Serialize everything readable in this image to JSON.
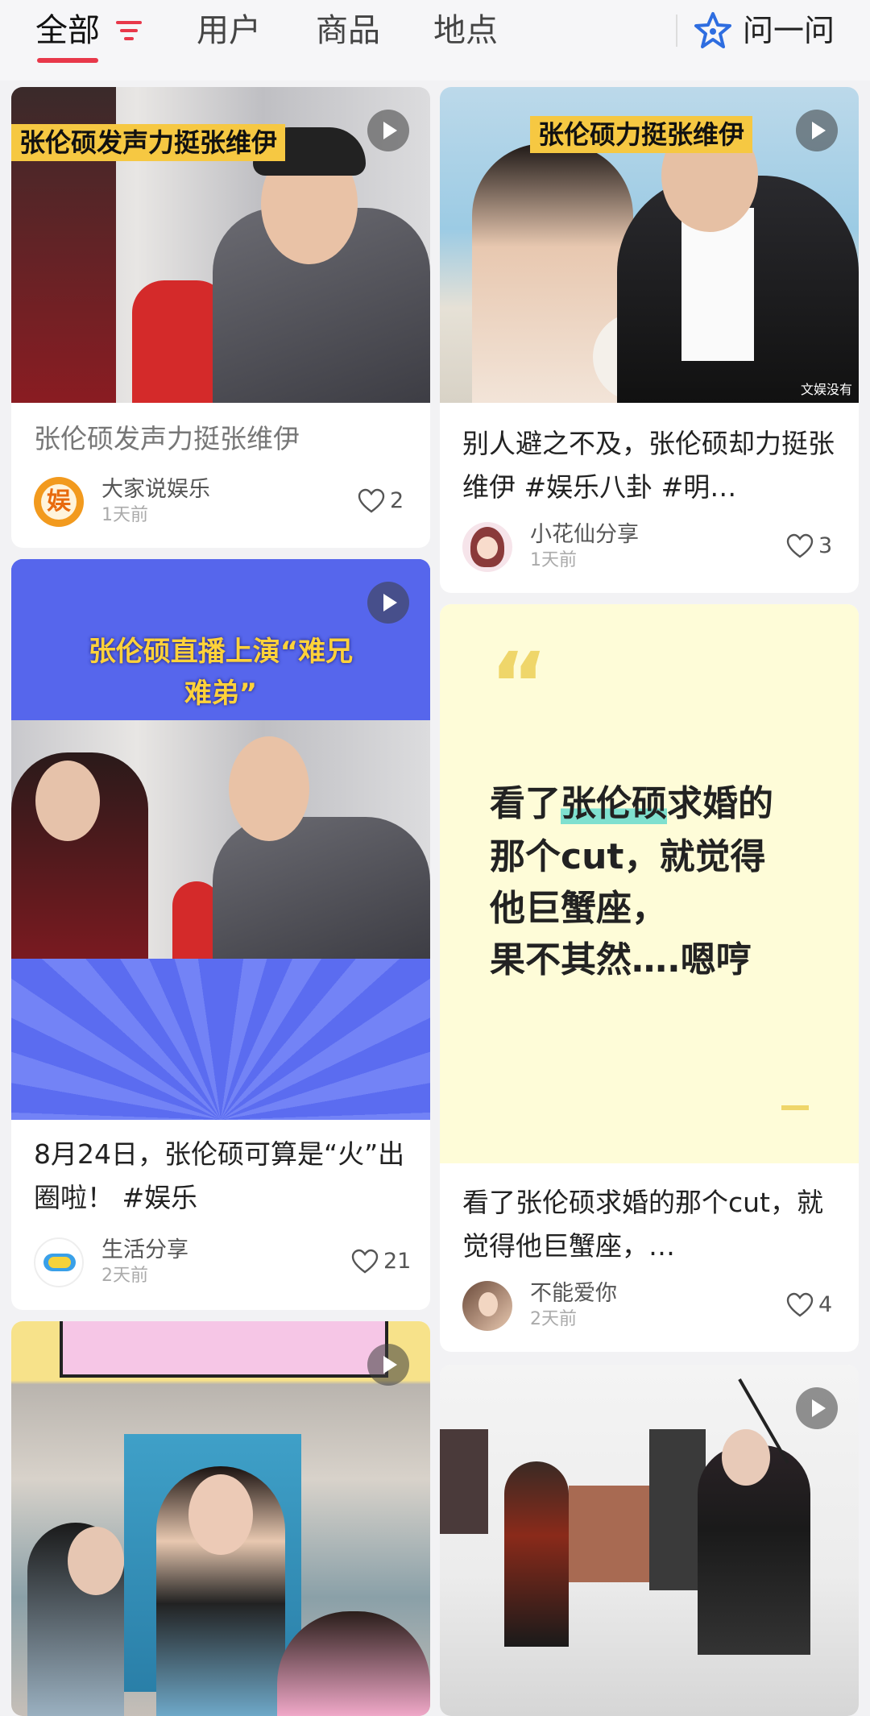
{
  "tabs": {
    "all": "全部",
    "users": "用户",
    "products": "商品",
    "places": "地点",
    "ask": "问一问"
  },
  "accent_color": "#e8384a",
  "cards": {
    "c1": {
      "banner": "张伦硕发声力挺张维伊",
      "title": "张伦硕发声力挺张维伊",
      "author": "大家说娱乐",
      "avatar_text": "娱",
      "time": "1天前",
      "likes": "2"
    },
    "c2": {
      "banner": "张伦硕力挺张维伊",
      "watermark": "文娱没有",
      "title": "别人避之不及，张伦硕却力挺张维伊 #娱乐八卦 #明…",
      "author": "小花仙分享",
      "time": "1天前",
      "likes": "3"
    },
    "c3": {
      "banner_line1": "张伦硕直播上演“难兄",
      "banner_line2": "难弟”",
      "title": "8月24日，张伦硕可算是“火”出圈啦！ #娱乐",
      "author": "生活分享",
      "time": "2天前",
      "likes": "21"
    },
    "c4": {
      "quote_mark": "“",
      "quote_highlight": "张伦硕",
      "quote_before": "看了",
      "quote_after": "求婚的",
      "quote_line2": "那个cut，就觉得",
      "quote_line3": "他巨蟹座，",
      "quote_line4": "果不其然….嗯哼",
      "title": "看了张伦硕求婚的那个cut，就觉得他巨蟹座，…",
      "author": "不能爱你",
      "time": "2天前",
      "likes": "4"
    },
    "c5": {},
    "c6": {}
  }
}
